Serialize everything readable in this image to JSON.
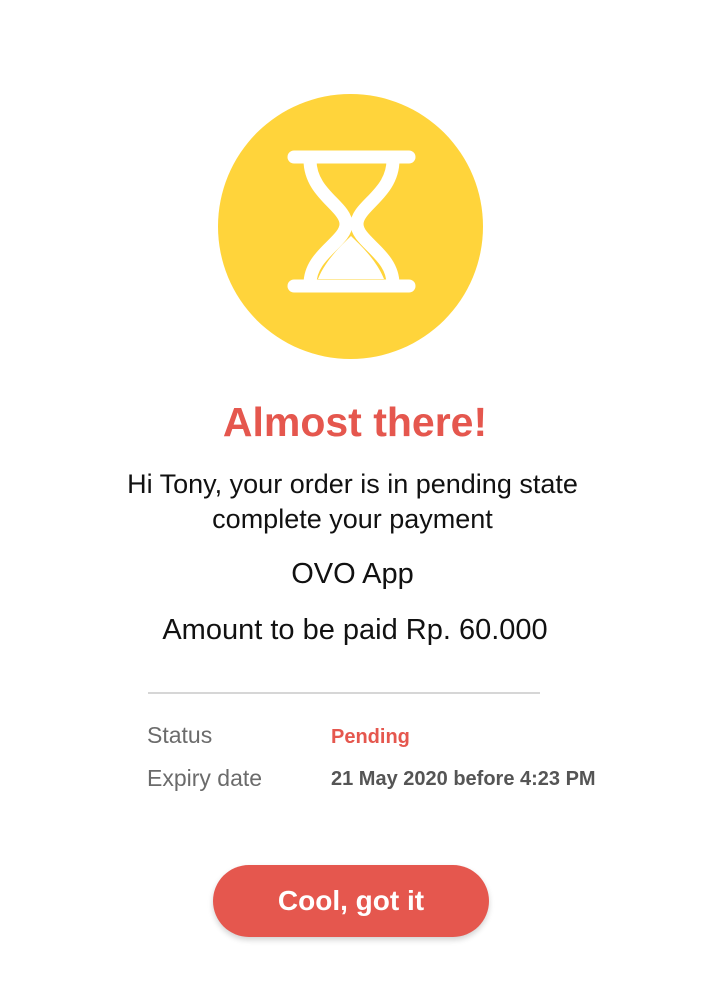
{
  "status_icon": {
    "name": "hourglass-icon",
    "background_color": "#FFD43B",
    "glyph_color": "#FFFFFF"
  },
  "header": {
    "title": "Almost there!",
    "title_color": "#E5574E"
  },
  "message": {
    "line1": "Hi Tony, your order is in pending state",
    "line2": "complete your payment"
  },
  "payment": {
    "method": "OVO App",
    "amount_text": "Amount to be paid  Rp. 60.000"
  },
  "details": {
    "status_label": "Status",
    "status_value": "Pending",
    "status_color": "#E5574E",
    "expiry_label": "Expiry date",
    "expiry_value": "21 May 2020 before 4:23 PM"
  },
  "actions": {
    "confirm_label": "Cool, got it",
    "confirm_color": "#E5574E"
  }
}
